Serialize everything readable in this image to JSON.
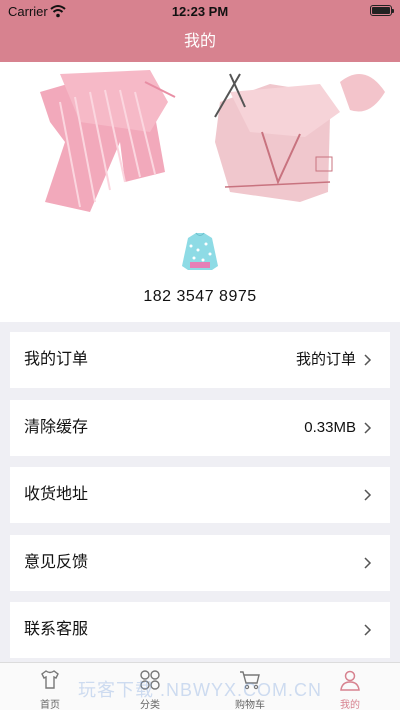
{
  "status_bar": {
    "carrier": "Carrier",
    "time": "12:23 PM"
  },
  "nav": {
    "title": "我的"
  },
  "profile": {
    "phone": "182 3547 8975"
  },
  "menu": [
    {
      "label": "我的订单",
      "value": "我的订单"
    },
    {
      "label": "清除缓存",
      "value": "0.33MB"
    },
    {
      "label": "收货地址",
      "value": ""
    },
    {
      "label": "意见反馈",
      "value": ""
    },
    {
      "label": "联系客服",
      "value": ""
    }
  ],
  "tabs": [
    {
      "label": "首页",
      "icon": "shirt-icon"
    },
    {
      "label": "分类",
      "icon": "category-icon"
    },
    {
      "label": "购物车",
      "icon": "cart-icon"
    },
    {
      "label": "我的",
      "icon": "person-icon"
    }
  ],
  "watermark": "玩客下载 .NBWYX.COM.CN",
  "colors": {
    "accent": "#d7828f",
    "background": "#efeff4"
  }
}
